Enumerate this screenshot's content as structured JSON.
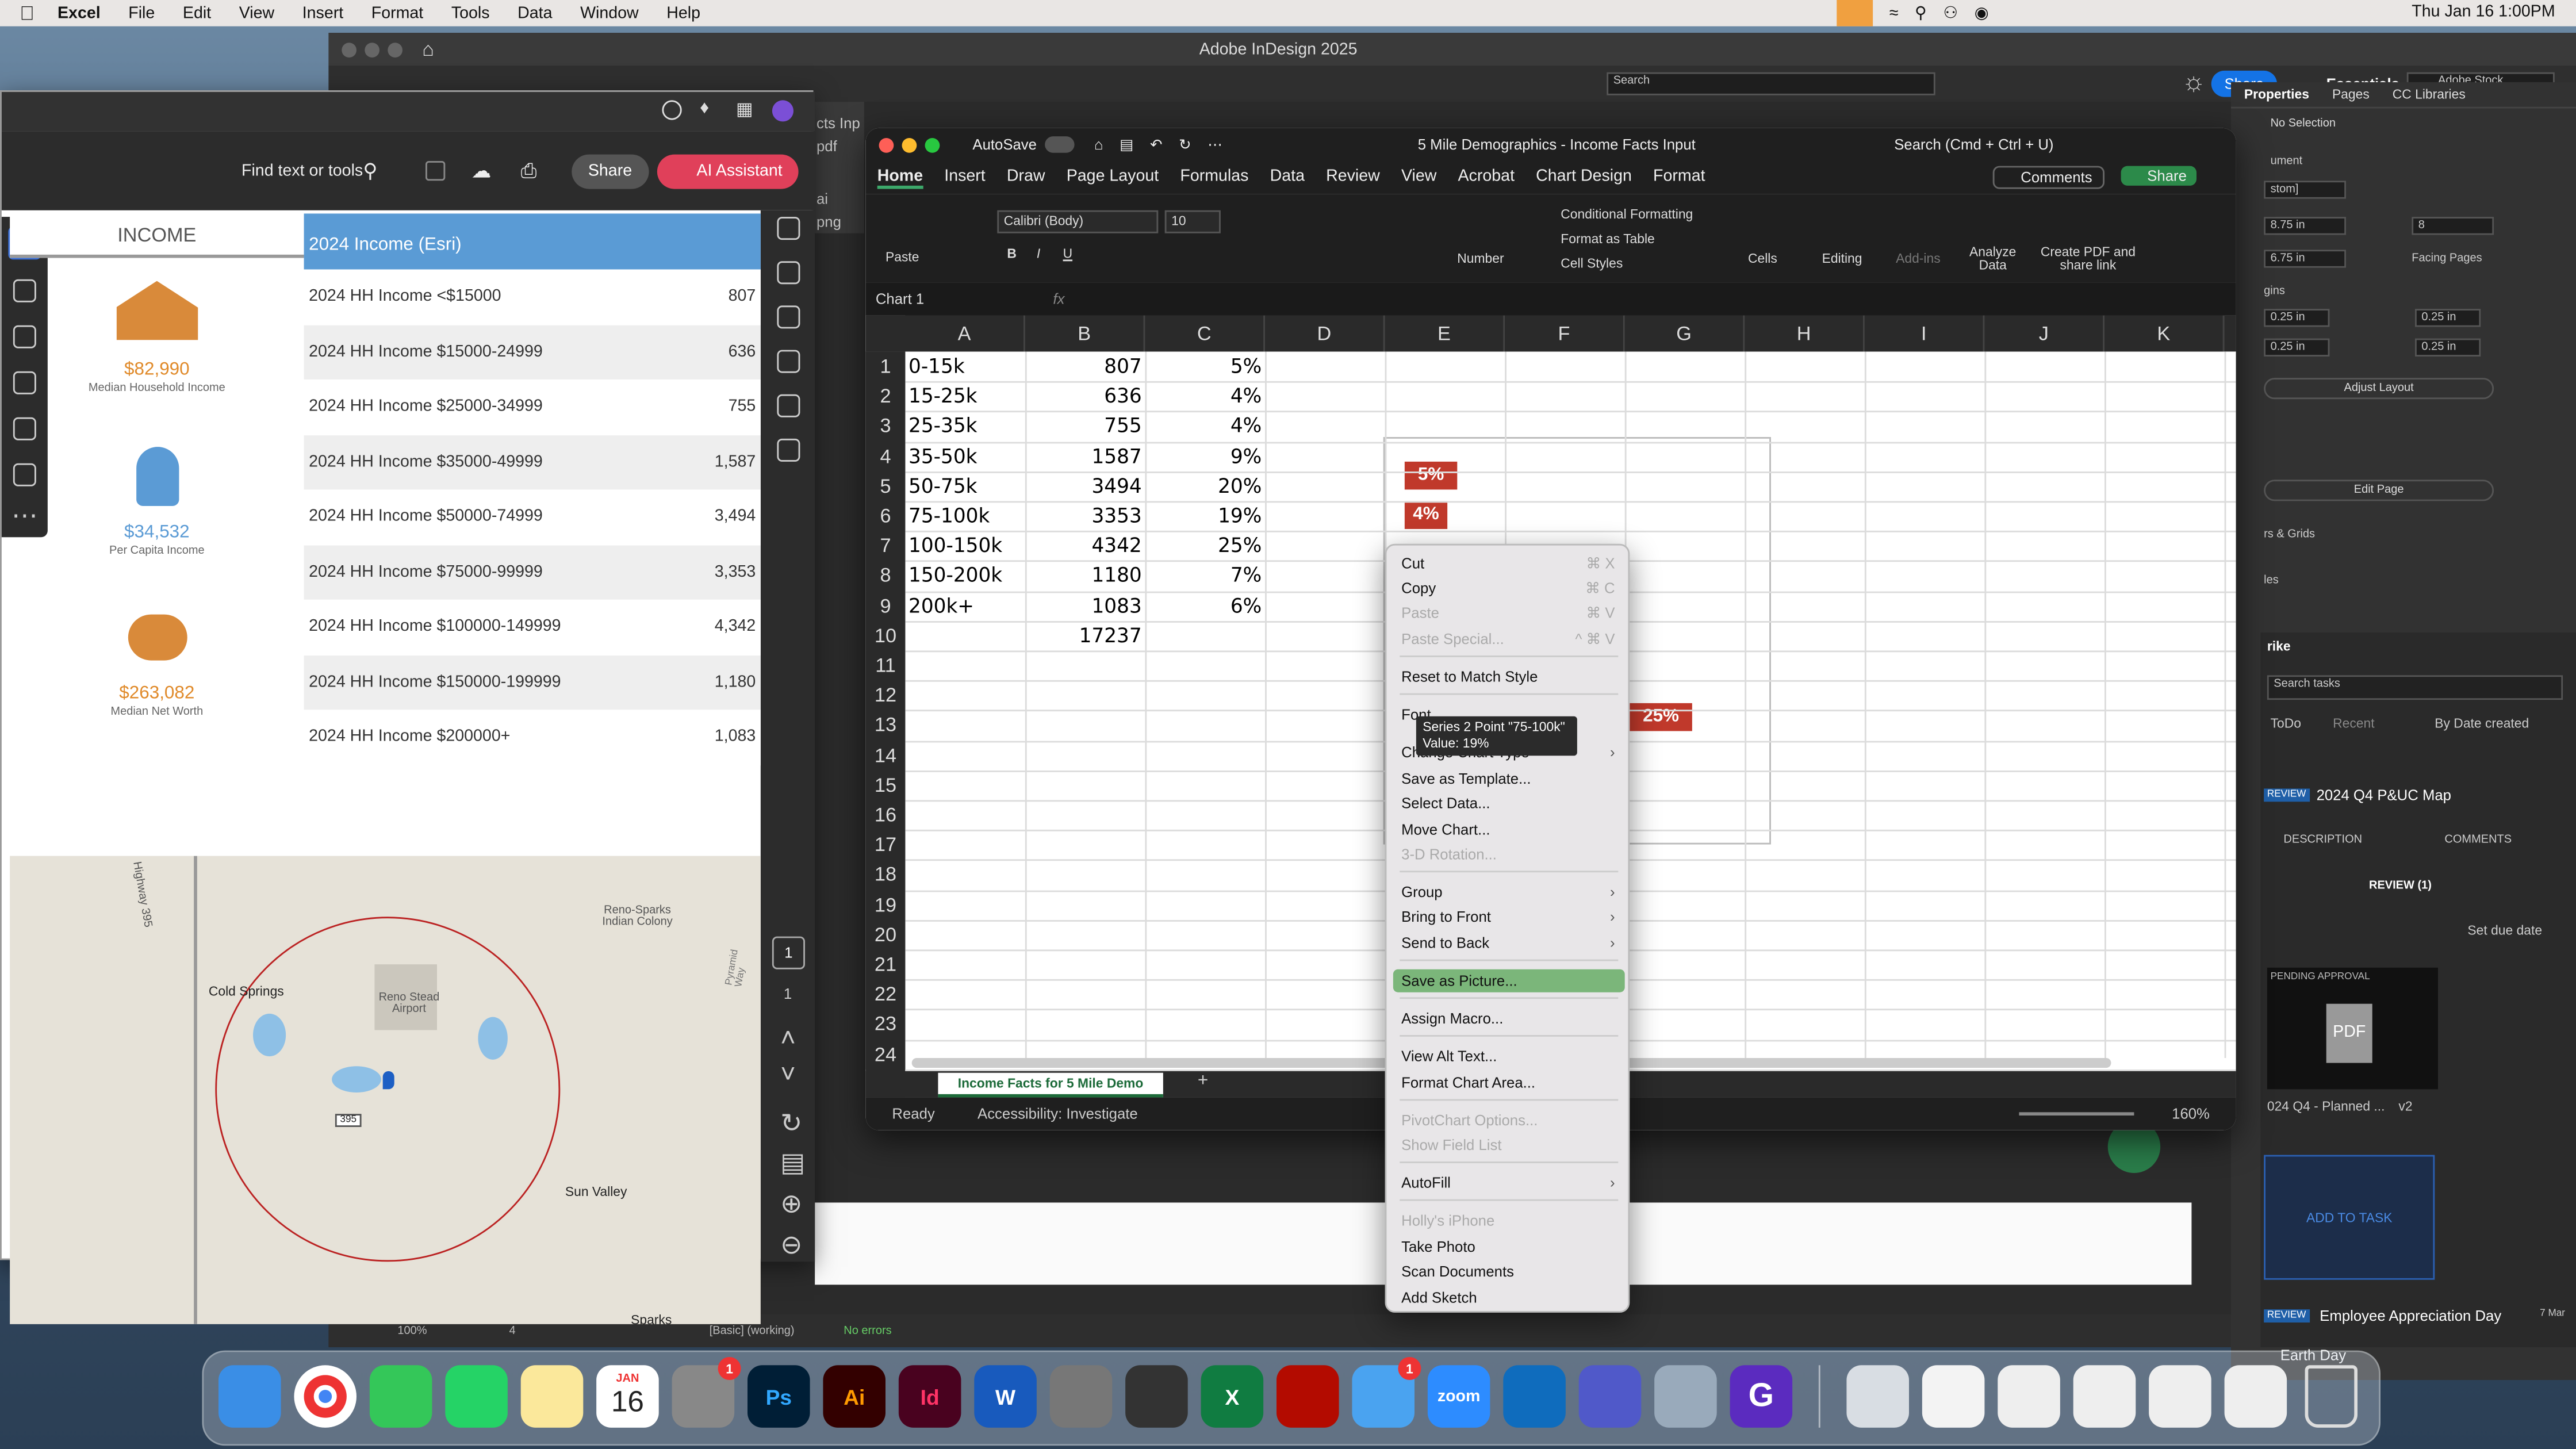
{
  "menubar": {
    "app": "Excel",
    "items": [
      "File",
      "Edit",
      "View",
      "Insert",
      "Format",
      "Tools",
      "Data",
      "Window",
      "Help"
    ],
    "datetime": "Thu Jan 16  1:00PM"
  },
  "indesign": {
    "title": "Adobe InDesign 2025",
    "share": "Share",
    "workspace": "Essentials",
    "stock_placeholder": "Adobe Stock",
    "search_placeholder": "Search",
    "tabs": [
      "Properties",
      "Pages",
      "CC Libraries"
    ],
    "no_selection": "No Selection",
    "document": "ument",
    "custom": "stom]",
    "width": "8.75 in",
    "height": "6.75 in",
    "pages": "8",
    "facing": "Facing Pages",
    "margins": "gins",
    "margin_vals": [
      "0.25 in",
      "0.25 in",
      "0.25 in",
      "0.25 in"
    ],
    "adjust_layout": "Adjust Layout",
    "edit_page": "Edit Page",
    "guides": "rs & Grids",
    "styles": "les",
    "zoom": "100%",
    "page": "4",
    "working": "[Basic] (working)",
    "errors": "No errors",
    "sidebar_links": [
      "cts Inp",
      "pdf",
      "ai",
      "png"
    ]
  },
  "tasks": {
    "title": "rike",
    "search_placeholder": "Search tasks",
    "todo": "ToDo",
    "recent": "Recent",
    "sort": "By Date created",
    "review_badge": "REVIEW",
    "task1": "2024 Q4 P&UC Map",
    "description": "DESCRIPTION",
    "comments": "COMMENTS",
    "review_count": "REVIEW (1)",
    "set_due": "Set due date",
    "pending": "PENDING APPROVAL",
    "pdf": "PDF",
    "file_name": "024 Q4 - Planned ...",
    "file_version": "v2",
    "add_task": "ADD TO TASK",
    "task2": "Employee Appreciation Day",
    "task2_date": "7 Mar",
    "task3": "Earth Day"
  },
  "acrobat": {
    "find_placeholder": "Find text or tools",
    "share": "Share",
    "ai": "AI Assistant",
    "income_header": "INCOME",
    "table_header": "2024 Income (Esri)",
    "metrics": [
      {
        "value": "$82,990",
        "label": "Median Household Income"
      },
      {
        "value": "$34,532",
        "label": "Per Capita Income"
      },
      {
        "value": "$263,082",
        "label": "Median Net Worth"
      }
    ],
    "rows": [
      {
        "label": "2024 HH Income <$15000",
        "value": "807"
      },
      {
        "label": "2024 HH Income $15000-24999",
        "value": "636"
      },
      {
        "label": "2024 HH Income $25000-34999",
        "value": "755"
      },
      {
        "label": "2024 HH Income $35000-49999",
        "value": "1,587"
      },
      {
        "label": "2024 HH Income $50000-74999",
        "value": "3,494"
      },
      {
        "label": "2024 HH Income $75000-99999",
        "value": "3,353"
      },
      {
        "label": "2024 HH Income $100000-149999",
        "value": "4,342"
      },
      {
        "label": "2024 HH Income $150000-199999",
        "value": "1,180"
      },
      {
        "label": "2024 HH Income $200000+",
        "value": "1,083"
      }
    ],
    "map": {
      "places": [
        "Cold Springs",
        "Reno Stead Airport",
        "Reno-Sparks Indian Colony",
        "Sun Valley",
        "Sparks",
        "Highway 395",
        "Pyramid Way",
        "395"
      ]
    },
    "page_nums": [
      "1",
      "1"
    ]
  },
  "excel": {
    "autosave": "AutoSave",
    "title": "5 Mile Demographics - Income Facts Input",
    "search": "Search (Cmd + Ctrl + U)",
    "tabs": [
      "Home",
      "Insert",
      "Draw",
      "Page Layout",
      "Formulas",
      "Data",
      "Review",
      "View",
      "Acrobat",
      "Chart Design",
      "Format"
    ],
    "comments": "Comments",
    "share": "Share",
    "font": "Calibri (Body)",
    "size": "10",
    "ribbon": {
      "paste": "Paste",
      "number": "Number",
      "cond": "Conditional Formatting",
      "table": "Format as Table",
      "styles": "Cell Styles",
      "cells": "Cells",
      "editing": "Editing",
      "addins": "Add-ins",
      "analyze": "Analyze Data",
      "create_pdf": "Create PDF and share link"
    },
    "namebox": "Chart 1",
    "cols": [
      "A",
      "B",
      "C",
      "D",
      "E",
      "F",
      "G",
      "H",
      "I",
      "J",
      "K"
    ],
    "rows": [
      [
        "0-15k",
        "807",
        "5%"
      ],
      [
        "15-25k",
        "636",
        "4%"
      ],
      [
        "25-35k",
        "755",
        "4%"
      ],
      [
        "35-50k",
        "1587",
        "9%"
      ],
      [
        "50-75k",
        "3494",
        "20%"
      ],
      [
        "75-100k",
        "3353",
        "19%"
      ],
      [
        "100-150k",
        "4342",
        "25%"
      ],
      [
        "150-200k",
        "1180",
        "7%"
      ],
      [
        "200k+",
        "1083",
        "6%"
      ],
      [
        "",
        "17237",
        ""
      ]
    ],
    "rownums": [
      "1",
      "2",
      "3",
      "4",
      "5",
      "6",
      "7",
      "8",
      "9",
      "10",
      "11",
      "12",
      "13",
      "14",
      "15",
      "16",
      "17",
      "18",
      "19",
      "20",
      "21",
      "22",
      "23",
      "24"
    ],
    "sheet": "Income Facts for 5 Mile Demo",
    "status": "Ready",
    "access": "Accessibility: Investigate",
    "zoom": "160%"
  },
  "chart_labels": [
    "5%",
    "4%",
    "25%"
  ],
  "tooltip": {
    "line1": "Series 2 Point \"75-100k\"",
    "line2": "Value: 19%"
  },
  "context_menu": {
    "cut": "Cut",
    "cut_sc": "⌘ X",
    "copy": "Copy",
    "copy_sc": "⌘ C",
    "paste": "Paste",
    "paste_sc": "⌘ V",
    "paste_special": "Paste Special...",
    "paste_special_sc": "^ ⌘ V",
    "reset": "Reset to Match Style",
    "font": "Font...",
    "change_type": "Change Chart Type",
    "save_template": "Save as Template...",
    "select_data": "Select Data...",
    "move_chart": "Move Chart...",
    "rotation": "3-D Rotation...",
    "group": "Group",
    "front": "Bring to Front",
    "back": "Send to Back",
    "save_picture": "Save as Picture...",
    "macro": "Assign Macro...",
    "alt_text": "View Alt Text...",
    "format_area": "Format Chart Area...",
    "pivot": "PivotChart Options...",
    "field_list": "Show Field List",
    "autofill": "AutoFill",
    "iphone": "Holly's iPhone",
    "photo": "Take Photo",
    "scan": "Scan Documents",
    "sketch": "Add Sketch"
  },
  "dock": {
    "calendar_month": "JAN",
    "calendar_day": "16",
    "badge1": "1",
    "badge2": "1",
    "zoom": "zoom",
    "labels": [
      "Ps",
      "Ai",
      "Id",
      "W",
      "X",
      "G"
    ]
  }
}
